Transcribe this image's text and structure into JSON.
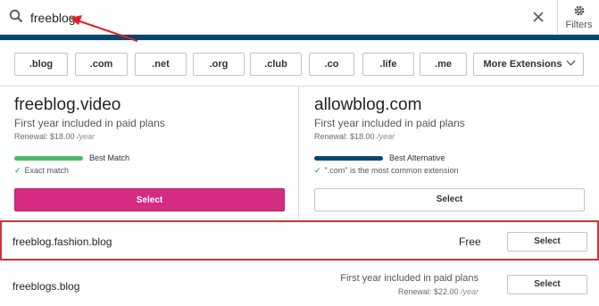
{
  "search": {
    "value": "freeblog",
    "filters_label": "Filters"
  },
  "tlds": [
    ".blog",
    ".com",
    ".net",
    ".org",
    ".club",
    ".co",
    ".life",
    ".me"
  ],
  "more_extensions_label": "More Extensions",
  "featured": [
    {
      "domain": "freeblog.video",
      "price_text": "First year included in paid plans",
      "renewal": "Renewal: $18.00",
      "renewal_unit": "/year",
      "badge": "Best Match",
      "badge_color": "#4ab866",
      "note": "Exact match",
      "select_label": "Select"
    },
    {
      "domain": "allowblog.com",
      "price_text": "First year included in paid plans",
      "renewal": "Renewal: $18.00",
      "renewal_unit": "/year",
      "badge": "Best Alternative",
      "badge_color": "#02486f",
      "note": "\".com\" is the most common extension",
      "select_label": "Select"
    }
  ],
  "results": [
    {
      "domain": "freeblog.fashion.blog",
      "price": "Free",
      "select_label": "Select"
    },
    {
      "domain": "freeblogs.blog",
      "price_text": "First year included in paid plans",
      "renewal": "Renewal: $22.00",
      "renewal_unit": "/year",
      "select_label": "Select"
    }
  ],
  "colors": {
    "primary_button": "#d52c82",
    "accent_strip": "#02486f",
    "highlight_border": "#c9353a",
    "annotation_arrow": "#e02020"
  }
}
